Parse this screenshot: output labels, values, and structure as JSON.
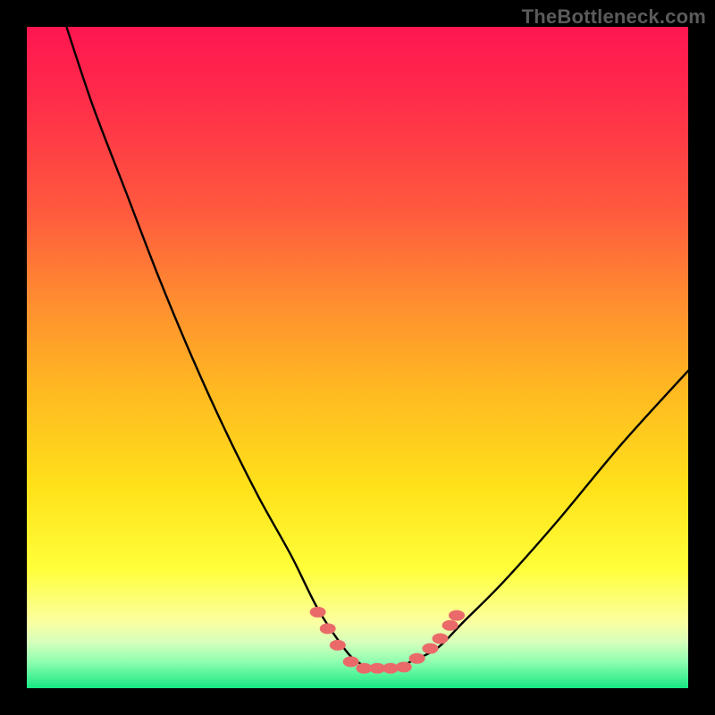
{
  "attribution": "TheBottleneck.com",
  "chart_data": {
    "type": "line",
    "title": "",
    "xlabel": "",
    "ylabel": "",
    "xlim": [
      0,
      100
    ],
    "ylim": [
      0,
      100
    ],
    "series": [
      {
        "name": "bottleneck-curve",
        "x": [
          6,
          10,
          15,
          20,
          25,
          30,
          35,
          40,
          44,
          48,
          50,
          52,
          54,
          56,
          58,
          62,
          66,
          72,
          80,
          90,
          100
        ],
        "values": [
          100,
          88,
          75,
          62,
          50,
          39,
          29,
          20,
          12,
          6,
          4,
          3,
          3,
          3,
          4,
          6,
          10,
          16,
          25,
          37,
          48
        ]
      }
    ],
    "markers": [
      {
        "x": 44.0,
        "y": 11.5
      },
      {
        "x": 45.5,
        "y": 9.0
      },
      {
        "x": 47.0,
        "y": 6.5
      },
      {
        "x": 49.0,
        "y": 4.0
      },
      {
        "x": 51.0,
        "y": 3.0
      },
      {
        "x": 53.0,
        "y": 3.0
      },
      {
        "x": 55.0,
        "y": 3.0
      },
      {
        "x": 57.0,
        "y": 3.2
      },
      {
        "x": 59.0,
        "y": 4.5
      },
      {
        "x": 61.0,
        "y": 6.0
      },
      {
        "x": 62.5,
        "y": 7.5
      },
      {
        "x": 64.0,
        "y": 9.5
      },
      {
        "x": 65.0,
        "y": 11.0
      }
    ],
    "marker_color": "#ea6a6a",
    "curve_color": "#000000",
    "gradient_stops": [
      {
        "pos": 0,
        "color": "#ff1650"
      },
      {
        "pos": 28,
        "color": "#ff5a3e"
      },
      {
        "pos": 55,
        "color": "#ffb921"
      },
      {
        "pos": 82,
        "color": "#ffff3a"
      },
      {
        "pos": 100,
        "color": "#17e884"
      }
    ]
  }
}
